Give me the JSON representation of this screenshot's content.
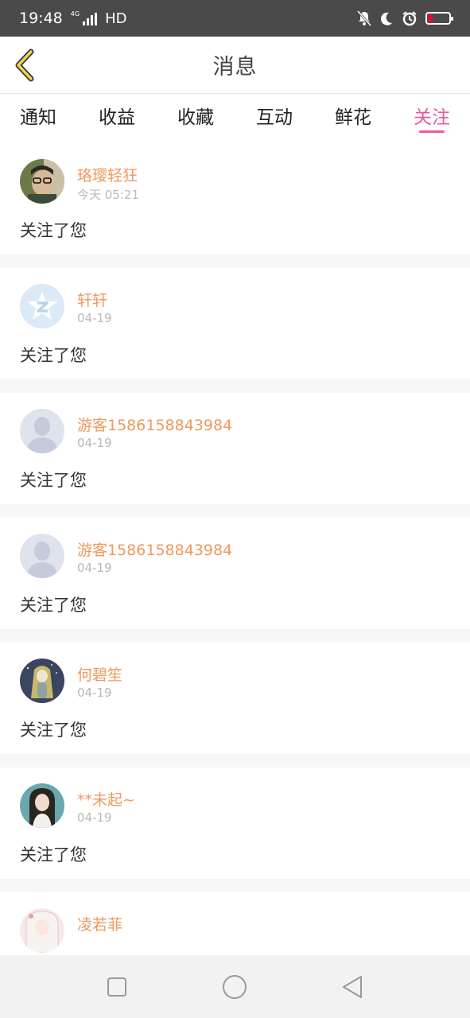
{
  "status_bar": {
    "time": "19:48",
    "network": "4G",
    "hd": "HD",
    "battery_color": "#e0102a"
  },
  "header": {
    "title": "消息",
    "back_icon": "chevron-left-icon",
    "accent_color": "#e8d35a"
  },
  "tabs": [
    {
      "label": "通知",
      "active": false
    },
    {
      "label": "收益",
      "active": false
    },
    {
      "label": "收藏",
      "active": false
    },
    {
      "label": "互动",
      "active": false
    },
    {
      "label": "鲜花",
      "active": false
    },
    {
      "label": "关注",
      "active": true
    }
  ],
  "active_color": "#e85a9f",
  "notifications": [
    {
      "name": "珞璎轻狂",
      "date": "今天 05:21",
      "message": "关注了您",
      "avatar": "photo-glasses-avatar"
    },
    {
      "name": "轩轩",
      "date": "04-19",
      "message": "关注了您",
      "avatar": "qq-logo-avatar"
    },
    {
      "name": "游客1586158843984",
      "date": "04-19",
      "message": "关注了您",
      "avatar": "default-user-avatar"
    },
    {
      "name": "游客1586158843984",
      "date": "04-19",
      "message": "关注了您",
      "avatar": "default-user-avatar"
    },
    {
      "name": "何碧笙",
      "date": "04-19",
      "message": "关注了您",
      "avatar": "anime-girl-avatar"
    },
    {
      "name": "**未起~",
      "date": "04-19",
      "message": "关注了您",
      "avatar": "girl-photo-avatar"
    },
    {
      "name": "凌若菲",
      "date": "",
      "message": "",
      "avatar": "anime-white-hair-avatar"
    }
  ],
  "nav_bar": {
    "recents_icon": "square-icon",
    "home_icon": "circle-icon",
    "back_icon": "triangle-back-icon"
  }
}
